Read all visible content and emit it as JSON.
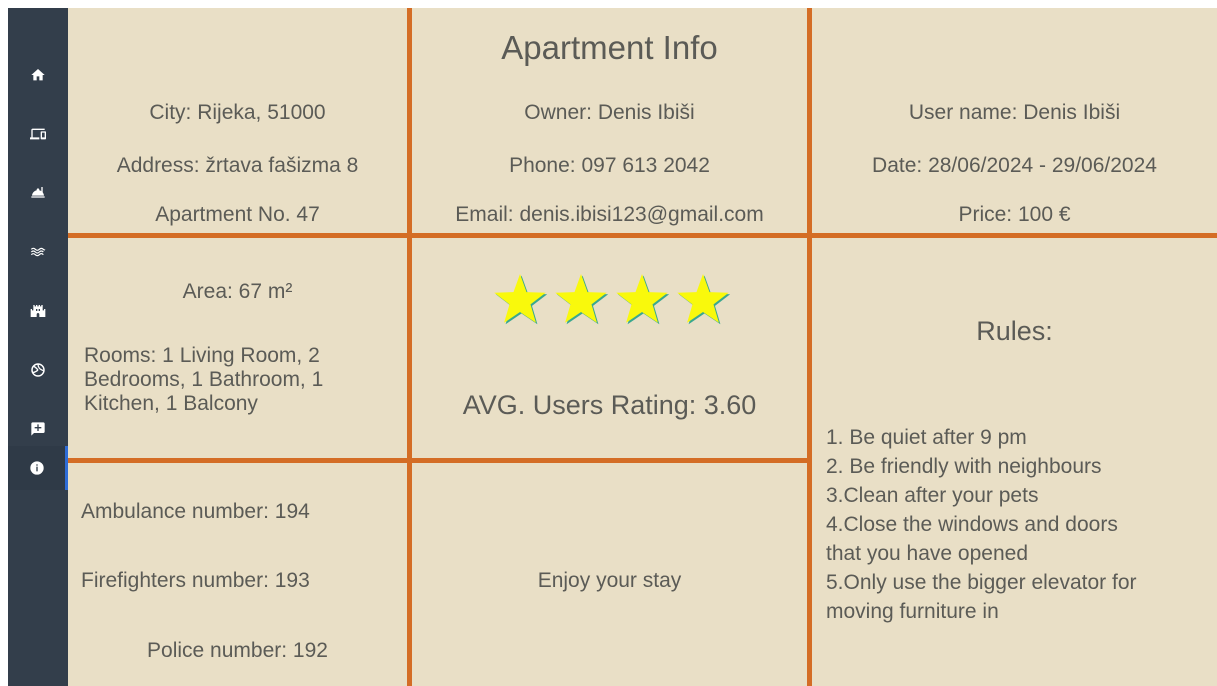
{
  "sidebar": {
    "items": [
      {
        "icon": "home-icon"
      },
      {
        "icon": "devices-icon"
      },
      {
        "icon": "room-service-icon"
      },
      {
        "icon": "waves-icon"
      },
      {
        "icon": "castle-icon"
      },
      {
        "icon": "volleyball-icon"
      },
      {
        "icon": "add-comment-icon"
      },
      {
        "icon": "info-icon"
      }
    ]
  },
  "location": {
    "city": "City: Rijeka, 51000",
    "address": "Address: žrtava fašizma 8",
    "apartment_no": "Apartment No. 47"
  },
  "owner": {
    "title": "Apartment Info",
    "owner": "Owner: Denis Ibiši",
    "phone": "Phone: 097 613 2042",
    "email": "Email: denis.ibisi123@gmail.com"
  },
  "booking": {
    "user": "User name: Denis Ibiši",
    "date": "Date: 28/06/2024 - 29/06/2024",
    "price": "Price: 100 €"
  },
  "details": {
    "area": "Area: 67 m²",
    "rooms": "Rooms: 1 Living Room, 2\nBedrooms, 1 Bathroom, 1\nKitchen, 1 Balcony"
  },
  "rating": {
    "stars": 4,
    "avg": "AVG. Users Rating: 3.60"
  },
  "emergency": {
    "ambulance": "Ambulance number: 194",
    "firefighters": "Firefighters number: 193",
    "police": "Police number: 192"
  },
  "greeting": "Enjoy your stay",
  "rules": {
    "title": "Rules:",
    "text": "1. Be quiet after 9 pm\n2. Be friendly with neighbours\n3.Clean after your pets\n4.Close the windows and doors\nthat you have opened\n5.Only use the bigger elevator for\nmoving furniture in"
  },
  "colors": {
    "background": "#e9dfc6",
    "divider": "#d46d25",
    "sidebar": "#333e4b",
    "star": "#f9f90c"
  }
}
